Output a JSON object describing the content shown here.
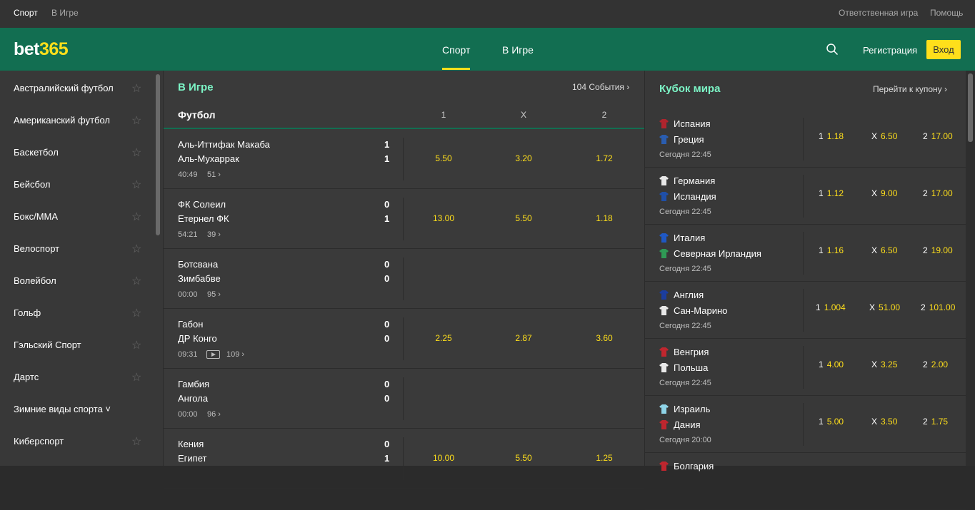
{
  "topbar": {
    "left": [
      "Спорт",
      "В Игре"
    ],
    "right": [
      "Ответственная игра",
      "Помощь"
    ]
  },
  "header": {
    "logo_white": "bet",
    "logo_yellow": "365",
    "tabs": [
      {
        "label": "Спорт"
      },
      {
        "label": "В Игре"
      }
    ],
    "active_tab": "Спорт",
    "register": "Регистрация",
    "login": "Вход",
    "search_icon": "search-icon"
  },
  "colors": {
    "brand_green": "#126e51",
    "accent_yellow": "#ffdf1b",
    "title_mint": "#7cf5c6"
  },
  "sidebar": {
    "items": [
      {
        "label": "Австралийский футбол"
      },
      {
        "label": "Американский футбол"
      },
      {
        "label": "Баскетбол"
      },
      {
        "label": "Бейсбол"
      },
      {
        "label": "Бокс/MMA"
      },
      {
        "label": "Велоспорт"
      },
      {
        "label": "Волейбол"
      },
      {
        "label": "Гольф"
      },
      {
        "label": "Гэльский Спорт"
      },
      {
        "label": "Дартс"
      },
      {
        "label": "Зимние виды спорта ˅"
      },
      {
        "label": "Киберспорт"
      }
    ]
  },
  "inplay": {
    "title": "В Игре",
    "events": "104 События ›",
    "sport": "Футбол",
    "cols": [
      "1",
      "X",
      "2"
    ],
    "matches": [
      {
        "home": "Аль-Иттифак Макаба",
        "away": "Аль-Мухаррак",
        "hs": "1",
        "as": "1",
        "time": "40:49",
        "count": "51 ›",
        "odds": [
          "5.50",
          "3.20",
          "1.72"
        ],
        "video": false
      },
      {
        "home": "ФК Солеил",
        "away": "Етернел ФК",
        "hs": "0",
        "as": "1",
        "time": "54:21",
        "count": "39 ›",
        "odds": [
          "13.00",
          "5.50",
          "1.18"
        ],
        "video": false
      },
      {
        "home": "Ботсвана",
        "away": "Зимбабве",
        "hs": "0",
        "as": "0",
        "time": "00:00",
        "count": "95 ›",
        "odds": [
          "",
          "",
          ""
        ],
        "video": false
      },
      {
        "home": "Габон",
        "away": "ДР Конго",
        "hs": "0",
        "as": "0",
        "time": "09:31",
        "count": "109 ›",
        "odds": [
          "2.25",
          "2.87",
          "3.60"
        ],
        "video": true
      },
      {
        "home": "Гамбия",
        "away": "Ангола",
        "hs": "0",
        "as": "0",
        "time": "00:00",
        "count": "96 ›",
        "odds": [
          "",
          "",
          ""
        ],
        "video": false
      },
      {
        "home": "Кения",
        "away": "Египет",
        "hs": "0",
        "as": "1",
        "time": "",
        "count": "",
        "odds": [
          "10.00",
          "5.50",
          "1.25"
        ],
        "video": false
      }
    ]
  },
  "coupon": {
    "title": "Кубок мира",
    "link": "Перейти к купону ›",
    "fixtures": [
      {
        "home": "Испания",
        "away": "Греция",
        "date": "Сегодня 22:45",
        "o1": "1.18",
        "ox": "6.50",
        "o2": "17.00",
        "c1": "#b0242d",
        "c2": "#2a5db0"
      },
      {
        "home": "Германия",
        "away": "Исландия",
        "date": "Сегодня 22:45",
        "o1": "1.12",
        "ox": "9.00",
        "o2": "17.00",
        "c1": "#e8e8e8",
        "c2": "#1f4fa8"
      },
      {
        "home": "Италия",
        "away": "Северная Ирландия",
        "date": "Сегодня 22:45",
        "o1": "1.16",
        "ox": "6.50",
        "o2": "19.00",
        "c1": "#1f58c4",
        "c2": "#2f9a55"
      },
      {
        "home": "Англия",
        "away": "Сан-Марино",
        "date": "Сегодня 22:45",
        "o1": "1.004",
        "ox": "51.00",
        "o2": "101.00",
        "c1": "#1b3d9e",
        "c2": "#e8e8e8"
      },
      {
        "home": "Венгрия",
        "away": "Польша",
        "date": "Сегодня 22:45",
        "o1": "4.00",
        "ox": "3.25",
        "o2": "2.00",
        "c1": "#c0262e",
        "c2": "#e8e8e8"
      },
      {
        "home": "Израиль",
        "away": "Дания",
        "date": "Сегодня 20:00",
        "o1": "5.00",
        "ox": "3.50",
        "o2": "1.75",
        "c1": "#8fd4e8",
        "c2": "#c0262e"
      },
      {
        "home": "Болгария",
        "away": "",
        "date": "",
        "o1": "",
        "ox": "",
        "o2": "",
        "c1": "#c0262e",
        "c2": ""
      }
    ]
  }
}
